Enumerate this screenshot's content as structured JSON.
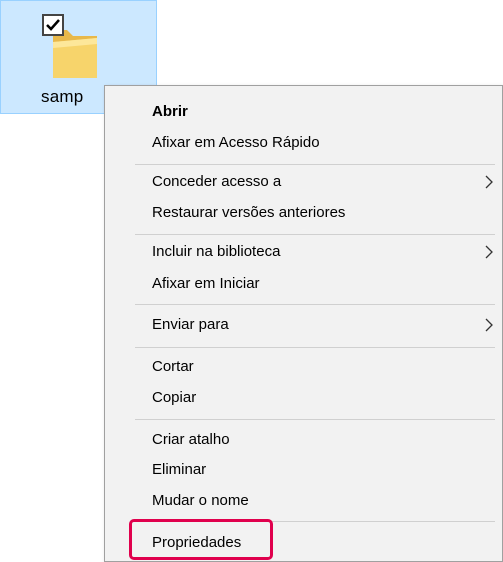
{
  "folder": {
    "label": "samp",
    "selected": true
  },
  "menu": {
    "groups": [
      [
        {
          "label": "Abrir",
          "bold": true
        },
        {
          "label": "Afixar em Acesso Rápido"
        }
      ],
      [
        {
          "label": "Conceder acesso a",
          "submenu": true
        },
        {
          "label": "Restaurar versões anteriores"
        }
      ],
      [
        {
          "label": "Incluir na biblioteca",
          "submenu": true
        },
        {
          "label": "Afixar em Iniciar"
        }
      ],
      [
        {
          "label": "Enviar para",
          "submenu": true
        }
      ],
      [
        {
          "label": "Cortar"
        },
        {
          "label": "Copiar"
        }
      ],
      [
        {
          "label": "Criar atalho"
        },
        {
          "label": "Eliminar"
        },
        {
          "label": "Mudar o nome"
        }
      ],
      [
        {
          "label": "Propriedades",
          "highlighted": true
        }
      ]
    ]
  },
  "colors": {
    "selection_bg": "#cce8ff",
    "menu_bg": "#f2f2f2",
    "highlight_border": "#e0004d"
  },
  "icons": [
    "checkbox-icon",
    "folder-icon",
    "chevron-right-icon"
  ]
}
